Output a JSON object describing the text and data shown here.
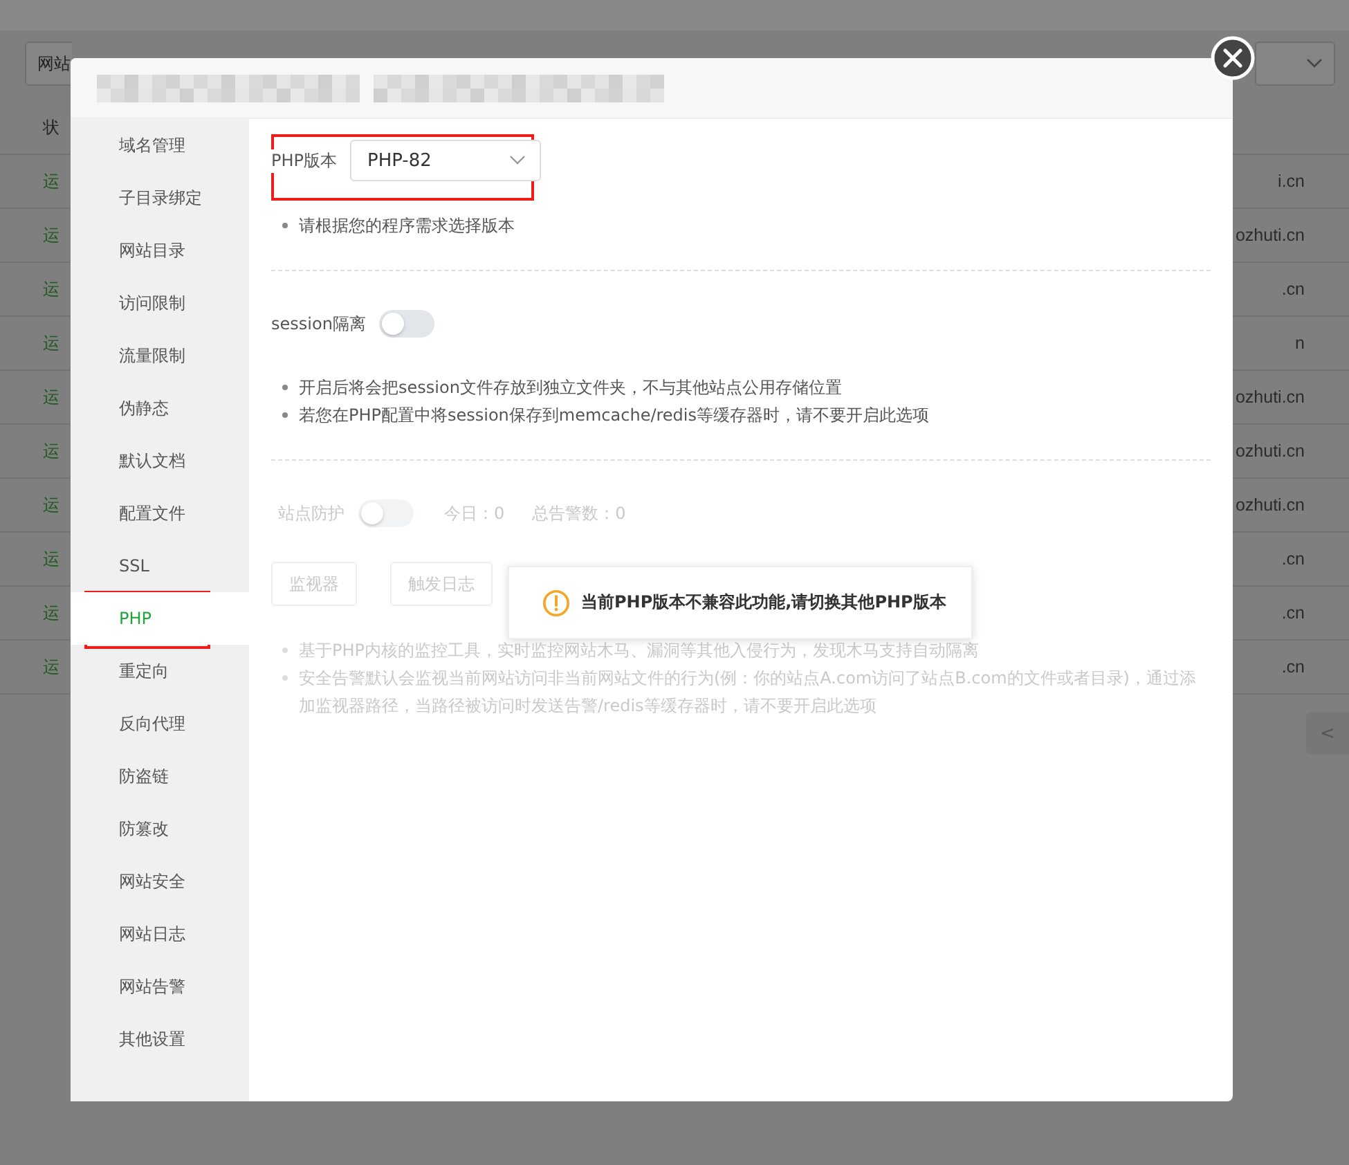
{
  "background": {
    "toolbar_button": "网站",
    "header": "状",
    "rows": [
      {
        "status": "运",
        "domain": "i.cn"
      },
      {
        "status": "运",
        "domain": "ozhuti.cn"
      },
      {
        "status": "运",
        "domain": ".cn"
      },
      {
        "status": "运",
        "domain": "n"
      },
      {
        "status": "运",
        "domain": "ozhuti.cn"
      },
      {
        "status": "运",
        "domain": "ozhuti.cn"
      },
      {
        "status": "运",
        "domain": "ozhuti.cn"
      },
      {
        "status": "运",
        "domain": ".cn"
      },
      {
        "status": "运",
        "domain": ".cn"
      },
      {
        "status": "运",
        "domain": ".cn"
      }
    ],
    "pager": "<"
  },
  "dialog": {
    "sidebar": {
      "items": [
        {
          "label": "域名管理",
          "selected": false,
          "highlighted": false
        },
        {
          "label": "子目录绑定",
          "selected": false,
          "highlighted": false
        },
        {
          "label": "网站目录",
          "selected": false,
          "highlighted": false
        },
        {
          "label": "访问限制",
          "selected": false,
          "highlighted": false
        },
        {
          "label": "流量限制",
          "selected": false,
          "highlighted": false
        },
        {
          "label": "伪静态",
          "selected": false,
          "highlighted": false
        },
        {
          "label": "默认文档",
          "selected": false,
          "highlighted": false
        },
        {
          "label": "配置文件",
          "selected": false,
          "highlighted": false
        },
        {
          "label": "SSL",
          "selected": false,
          "highlighted": false
        },
        {
          "label": "PHP",
          "selected": true,
          "highlighted": true
        },
        {
          "label": "重定向",
          "selected": false,
          "highlighted": false
        },
        {
          "label": "反向代理",
          "selected": false,
          "highlighted": false
        },
        {
          "label": "防盗链",
          "selected": false,
          "highlighted": false
        },
        {
          "label": "防篡改",
          "selected": false,
          "highlighted": false
        },
        {
          "label": "网站安全",
          "selected": false,
          "highlighted": false
        },
        {
          "label": "网站日志",
          "selected": false,
          "highlighted": false
        },
        {
          "label": "网站告警",
          "selected": false,
          "highlighted": false
        },
        {
          "label": "其他设置",
          "selected": false,
          "highlighted": false
        }
      ]
    },
    "php_version": {
      "label": "PHP版本",
      "value": "PHP-82",
      "highlighted": true,
      "notes": [
        "请根据您的程序需求选择版本"
      ]
    },
    "session": {
      "label": "session隔离",
      "on": false,
      "notes": [
        "开启后将会把session文件存放到独立文件夹，不与其他站点公用存储位置",
        "若您在PHP配置中将session保存到memcache/redis等缓存器时，请不要开启此选项"
      ]
    },
    "site_protection": {
      "label": "站点防护",
      "on": false,
      "disabled": true,
      "today": "今日：0",
      "total": "总告警数：0",
      "buttons": [
        "监视器",
        "触发日志"
      ],
      "notes": [
        "基于PHP内核的监控工具，实时监控网站木马、漏洞等其他入侵行为，发现木马支持自动隔离",
        "安全告警默认会监视当前网站访问非当前网站文件的行为(例：你的站点A.com访问了站点B.com的文件或者目录)，通过添加监视器路径，当路径被访问时发送告警/redis等缓存器时，请不要开启此选项"
      ]
    },
    "toast": {
      "message": "当前PHP版本不兼容此功能,请切换其他PHP版本"
    }
  }
}
